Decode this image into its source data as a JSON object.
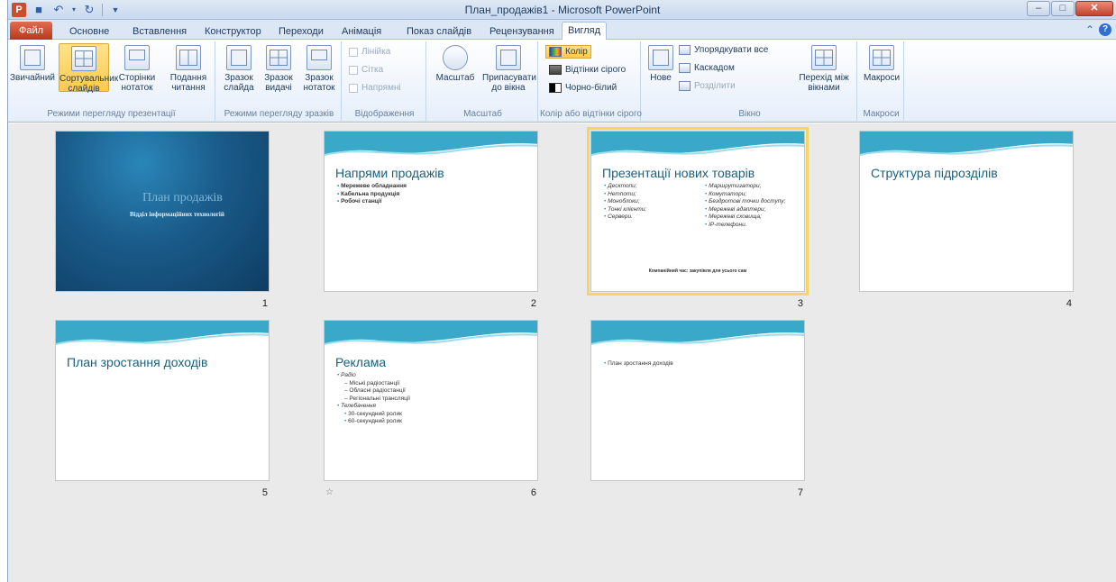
{
  "window": {
    "title": "План_продажів1 - Microsoft PowerPoint",
    "logo_letter": "P"
  },
  "tabs": {
    "file": "Файл",
    "home": "Основне",
    "insert": "Вставлення",
    "design": "Конструктор",
    "transitions": "Переходи",
    "animations": "Анімація",
    "slideshow": "Показ слайдів",
    "review": "Рецензування",
    "view": "Вигляд"
  },
  "ribbon": {
    "presentation_views": {
      "label": "Режими перегляду презентації",
      "normal": "Звичайний",
      "sorter": "Сортувальник слайдів",
      "notes_page": "Сторінки нотаток",
      "reading": "Подання читання"
    },
    "master_views": {
      "label": "Режими перегляду зразків",
      "slide_master": "Зразок слайда",
      "handout_master": "Зразок видачі",
      "notes_master": "Зразок нотаток"
    },
    "show": {
      "label": "Відображення",
      "ruler": "Лінійка",
      "grid": "Сітка",
      "guides": "Напрямні"
    },
    "zoom": {
      "label": "Масштаб",
      "zoom": "Масштаб",
      "fit": "Припасувати до вікна"
    },
    "color": {
      "label": "Колір або відтінки сірого",
      "color": "Колір",
      "grayscale": "Відтінки сірого",
      "bw": "Чорно-білий"
    },
    "window": {
      "label": "Вікно",
      "new": "Нове",
      "arrange": "Упорядкувати все",
      "cascade": "Каскадом",
      "split": "Розділити",
      "switch": "Перехід між вікнами"
    },
    "macros": {
      "label": "Макроси",
      "macros": "Макроси"
    }
  },
  "slides": [
    {
      "num": "1",
      "title": "План продажів",
      "subtitle": "Відділ інформаційних технологій"
    },
    {
      "num": "2",
      "title": "Напрями продажів",
      "bullets": [
        "Мережеве обладнання",
        "Кабельна продукція",
        "Робочі станції"
      ]
    },
    {
      "num": "3",
      "title": "Презентації нових товарів",
      "col1": [
        "Десктопи;",
        "Нетпоти;",
        "Моноблоки;",
        "Тонкі клієнти;",
        "Сервери."
      ],
      "col2": [
        "Маршрутизатори;",
        "Комутатори;",
        "Бездротові точки доступу;",
        "Мережеві адаптери;",
        "Мережеві сховища;",
        "IP-телефони."
      ],
      "footnote": "Компанійний час: закупівля для усього сам"
    },
    {
      "num": "4",
      "title": "Структура підрозділів"
    },
    {
      "num": "5",
      "title": "План зростання доходів"
    },
    {
      "num": "6",
      "title": "Реклама",
      "items": [
        "Радіо",
        "Міські радіостанції",
        "Обласні радіостанції",
        "Регіональні трансляції",
        "Телебачення",
        "30-секундний ролик",
        "60-секундний ролик"
      ]
    },
    {
      "num": "7",
      "bullet": "План зростання доходів"
    }
  ],
  "colors": {
    "selected_outline": "#f5d563",
    "title_teal": "#1c5f7c"
  }
}
